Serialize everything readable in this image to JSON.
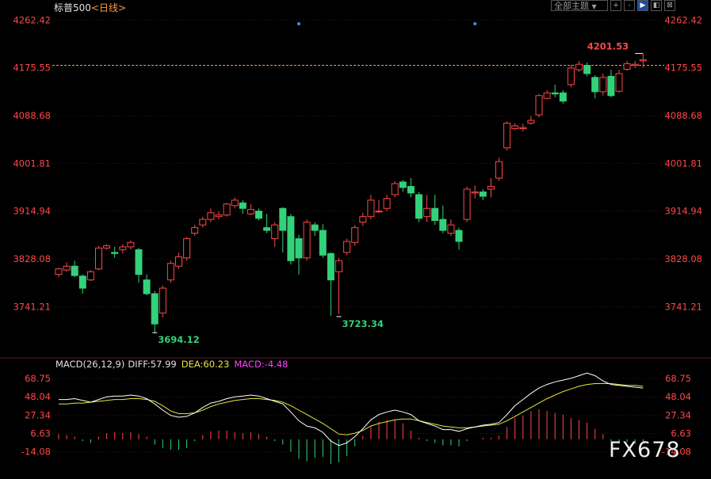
{
  "header": {
    "symbol": "标普500",
    "period": "<日线>"
  },
  "toolbar": {
    "theme_label": "全部主题",
    "arrow_glyph": "▼",
    "buttons": [
      "+",
      "-",
      "▶",
      "◧",
      "⊠"
    ]
  },
  "macd_header": {
    "name": "MACD(26,12,9)",
    "diff": "DIFF:57.99",
    "dea": "DEA:60.23",
    "macd": "MACD:-4.48"
  },
  "watermark": "FX678",
  "colors": {
    "up": "#ff4747",
    "down": "#33d17a",
    "axis_red": "#ff4747",
    "diff_line": "#ffffff",
    "dea_line": "#e6e640",
    "macd_label": "#ff40ff",
    "grid": "#3a1a1a",
    "ref_line": "#ff9c40"
  },
  "chart_data": [
    {
      "type": "candlestick",
      "y_ticks": [
        "4262.42",
        "4175.55",
        "4088.68",
        "4001.81",
        "3914.94",
        "3828.08",
        "3741.21"
      ],
      "ylim": [
        3680,
        4270
      ],
      "reference_line": 4180,
      "annotations": [
        {
          "text": "4201.53",
          "index": 72,
          "value": 4201.53,
          "kind": "high"
        },
        {
          "text": "3694.12",
          "index": 12,
          "value": 3694.12,
          "kind": "low"
        },
        {
          "text": "3723.34",
          "index": 35,
          "value": 3723.34,
          "kind": "low"
        }
      ],
      "markers": [
        {
          "index": 30
        },
        {
          "index": 52
        }
      ],
      "candles": [
        [
          3800,
          3810,
          3795,
          3812
        ],
        [
          3808,
          3815,
          3805,
          3822
        ],
        [
          3815,
          3798,
          3795,
          3825
        ],
        [
          3797,
          3775,
          3765,
          3800
        ],
        [
          3790,
          3805,
          3788,
          3808
        ],
        [
          3810,
          3848,
          3808,
          3852
        ],
        [
          3848,
          3852,
          3845,
          3855
        ],
        [
          3840,
          3838,
          3830,
          3850
        ],
        [
          3845,
          3850,
          3838,
          3855
        ],
        [
          3850,
          3858,
          3845,
          3862
        ],
        [
          3845,
          3800,
          3785,
          3848
        ],
        [
          3790,
          3765,
          3762,
          3800
        ],
        [
          3765,
          3710,
          3694,
          3770
        ],
        [
          3730,
          3775,
          3722,
          3780
        ],
        [
          3790,
          3820,
          3785,
          3825
        ],
        [
          3815,
          3832,
          3810,
          3840
        ],
        [
          3830,
          3865,
          3825,
          3868
        ],
        [
          3875,
          3885,
          3870,
          3890
        ],
        [
          3890,
          3900,
          3885,
          3905
        ],
        [
          3900,
          3912,
          3895,
          3920
        ],
        [
          3905,
          3908,
          3900,
          3915
        ],
        [
          3908,
          3928,
          3905,
          3930
        ],
        [
          3925,
          3935,
          3920,
          3940
        ],
        [
          3930,
          3920,
          3910,
          3935
        ],
        [
          3910,
          3918,
          3908,
          3928
        ],
        [
          3915,
          3902,
          3898,
          3920
        ],
        [
          3885,
          3880,
          3875,
          3910
        ],
        [
          3865,
          3890,
          3850,
          3895
        ],
        [
          3920,
          3880,
          3840,
          3922
        ],
        [
          3905,
          3825,
          3818,
          3910
        ],
        [
          3865,
          3830,
          3800,
          3872
        ],
        [
          3830,
          3895,
          3825,
          3900
        ],
        [
          3890,
          3880,
          3870,
          3895
        ],
        [
          3880,
          3835,
          3830,
          3892
        ],
        [
          3838,
          3790,
          3725,
          3840
        ],
        [
          3805,
          3825,
          3728,
          3830
        ],
        [
          3840,
          3860,
          3835,
          3865
        ],
        [
          3858,
          3885,
          3852,
          3890
        ],
        [
          3895,
          3905,
          3888,
          3912
        ],
        [
          3905,
          3935,
          3900,
          3945
        ],
        [
          3915,
          3915,
          3912,
          3935
        ],
        [
          3920,
          3938,
          3915,
          3945
        ],
        [
          3945,
          3965,
          3940,
          3970
        ],
        [
          3968,
          3958,
          3950,
          3972
        ],
        [
          3960,
          3948,
          3940,
          3975
        ],
        [
          3945,
          3902,
          3895,
          3950
        ],
        [
          3905,
          3920,
          3895,
          3945
        ],
        [
          3920,
          3898,
          3890,
          3945
        ],
        [
          3900,
          3880,
          3875,
          3925
        ],
        [
          3875,
          3890,
          3870,
          3900
        ],
        [
          3880,
          3860,
          3845,
          3885
        ],
        [
          3900,
          3955,
          3895,
          3960
        ],
        [
          3948,
          3950,
          3938,
          3962
        ],
        [
          3950,
          3942,
          3935,
          3955
        ],
        [
          3955,
          3960,
          3940,
          3975
        ],
        [
          3975,
          4005,
          3970,
          4012
        ],
        [
          4030,
          4075,
          4025,
          4078
        ],
        [
          4065,
          4070,
          4062,
          4075
        ],
        [
          4065,
          4067,
          4060,
          4074
        ],
        [
          4075,
          4080,
          4072,
          4088
        ],
        [
          4090,
          4125,
          4085,
          4128
        ],
        [
          4120,
          4130,
          4118,
          4135
        ],
        [
          4130,
          4128,
          4122,
          4145
        ],
        [
          4130,
          4115,
          4110,
          4135
        ],
        [
          4145,
          4175,
          4140,
          4180
        ],
        [
          4172,
          4182,
          4168,
          4188
        ],
        [
          4180,
          4165,
          4160,
          4185
        ],
        [
          4158,
          4132,
          4120,
          4162
        ],
        [
          4132,
          4158,
          4125,
          4165
        ],
        [
          4160,
          4125,
          4122,
          4172
        ],
        [
          4133,
          4165,
          4130,
          4172
        ],
        [
          4173,
          4183,
          4170,
          4188
        ],
        [
          4180,
          4182,
          4175,
          4188
        ],
        [
          4188,
          4190,
          4176,
          4201.53
        ]
      ]
    },
    {
      "type": "macd",
      "y_ticks": [
        "68.75",
        "48.04",
        "27.34",
        "6.63",
        "-14.08"
      ],
      "ylim": [
        -18,
        76
      ],
      "diff": [
        45,
        45,
        46,
        44,
        42,
        45,
        48,
        49,
        49,
        50,
        49,
        46,
        40,
        33,
        27,
        25,
        26,
        30,
        36,
        41,
        43,
        46,
        48,
        49,
        50,
        49,
        46,
        43,
        40,
        31,
        21,
        15,
        13,
        8,
        -2,
        -7,
        -4,
        3,
        12,
        22,
        28,
        31,
        33,
        31,
        28,
        21,
        18,
        15,
        11,
        11,
        9,
        12,
        14,
        16,
        17,
        19,
        28,
        38,
        45,
        52,
        58,
        62,
        65,
        67,
        69,
        72,
        75,
        72,
        66,
        62,
        61,
        60,
        59,
        58
      ],
      "dea": [
        40,
        40,
        41,
        41,
        42,
        43,
        44,
        45,
        45,
        46,
        46,
        45,
        43,
        38,
        32,
        29,
        29,
        30,
        33,
        37,
        40,
        42,
        44,
        45,
        46,
        46,
        45,
        44,
        42,
        38,
        33,
        28,
        23,
        18,
        12,
        6,
        5,
        7,
        10,
        15,
        18,
        20,
        22,
        23,
        23,
        21,
        19,
        17,
        15,
        14,
        13,
        13,
        14,
        15,
        16,
        17,
        21,
        26,
        31,
        36,
        41,
        46,
        50,
        54,
        57,
        60,
        62,
        63,
        63,
        63,
        62,
        61,
        61,
        60
      ],
      "macd_bars": [
        6,
        5,
        3,
        -2,
        -4,
        3,
        7,
        8,
        7,
        8,
        6,
        3,
        -6,
        -10,
        -12,
        -12,
        -10,
        -2,
        5,
        9,
        10,
        10,
        8,
        7,
        8,
        6,
        3,
        -2,
        -6,
        -14,
        -22,
        -25,
        -21,
        -20,
        -28,
        -26,
        -19,
        -8,
        4,
        14,
        20,
        22,
        22,
        18,
        10,
        2,
        -2,
        -4,
        -7,
        -7,
        -8,
        -2,
        0,
        2,
        2,
        4,
        14,
        24,
        27,
        32,
        34,
        32,
        30,
        28,
        24,
        22,
        19,
        12,
        6,
        -2,
        -3,
        -3,
        -5,
        -4
      ]
    }
  ]
}
